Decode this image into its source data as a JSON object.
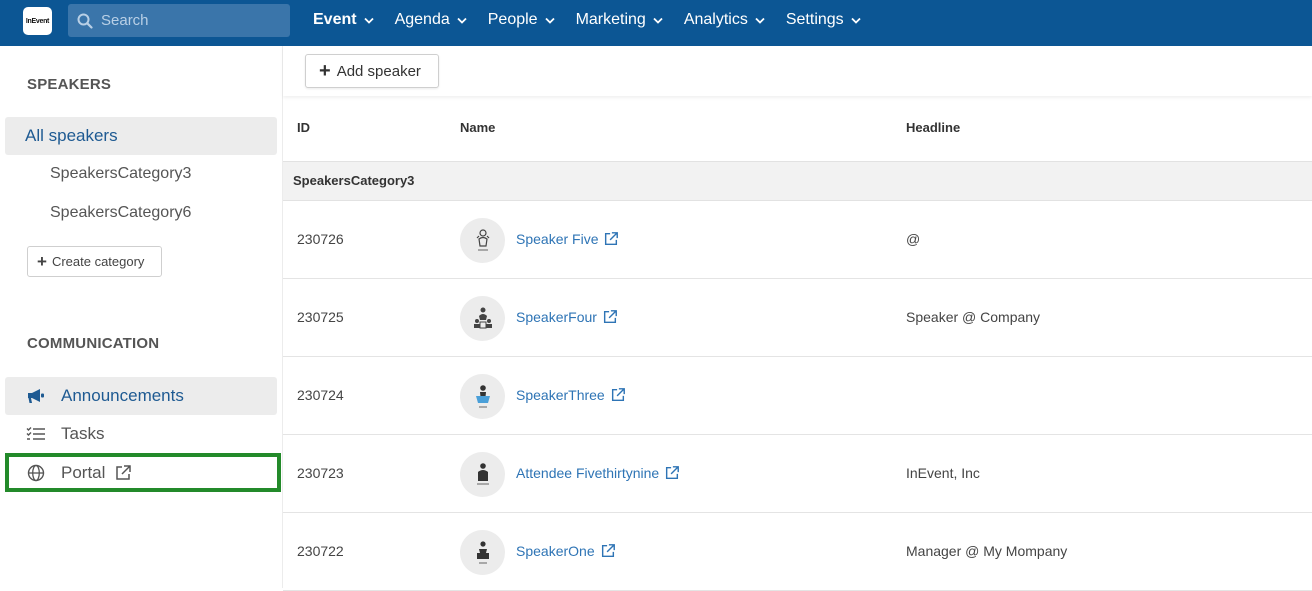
{
  "topbar": {
    "logo_text": "InEvent",
    "search_placeholder": "Search",
    "nav": [
      {
        "label": "Event",
        "active": true
      },
      {
        "label": "Agenda",
        "active": false
      },
      {
        "label": "People",
        "active": false
      },
      {
        "label": "Marketing",
        "active": false
      },
      {
        "label": "Analytics",
        "active": false
      },
      {
        "label": "Settings",
        "active": false
      }
    ]
  },
  "sidebar": {
    "speakers_heading": "SPEAKERS",
    "all_speakers": "All speakers",
    "categories": [
      "SpeakersCategory3",
      "SpeakersCategory6"
    ],
    "create_category": "Create category",
    "communication_heading": "COMMUNICATION",
    "comm_items": [
      {
        "label": "Announcements",
        "icon": "megaphone-icon"
      },
      {
        "label": "Tasks",
        "icon": "checklist-icon"
      },
      {
        "label": "Portal",
        "icon": "globe-icon"
      }
    ]
  },
  "toolbar": {
    "add_speaker": "Add speaker"
  },
  "table": {
    "columns": [
      "ID",
      "Name",
      "Headline"
    ],
    "group": "SpeakersCategory3",
    "rows": [
      {
        "id": "230726",
        "name": "Speaker Five",
        "headline": "@"
      },
      {
        "id": "230725",
        "name": "SpeakerFour",
        "headline": "Speaker @ Company"
      },
      {
        "id": "230724",
        "name": "SpeakerThree",
        "headline": ""
      },
      {
        "id": "230723",
        "name": "Attendee Fivethirtynine",
        "headline": "InEvent, Inc"
      },
      {
        "id": "230722",
        "name": "SpeakerOne",
        "headline": "Manager @ My Mompany"
      }
    ]
  },
  "colors": {
    "topbar": "#0c5694",
    "link": "#2e74b5",
    "highlight": "#238a2a"
  }
}
